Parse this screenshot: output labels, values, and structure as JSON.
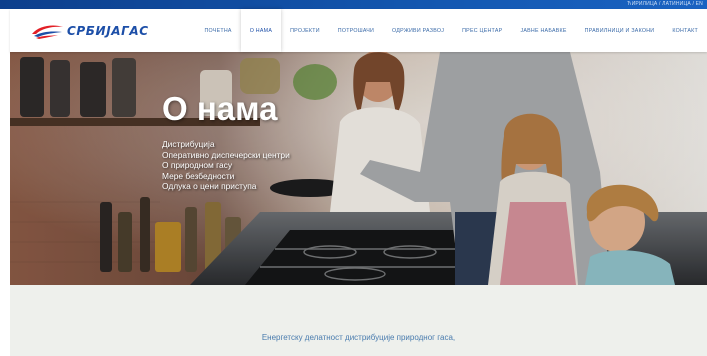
{
  "top_bar": {
    "language_link": "ЋИРИЛИЦА / ЛАТИНИЦА / EN",
    "color": "#1357b0"
  },
  "header": {
    "logo_text": "СРБИЈАГАС",
    "logo_icon": "gas-flame-logo-icon",
    "brand_color": "#1d4fa8",
    "nav": [
      {
        "label": "ПОЧЕТНА",
        "active": false
      },
      {
        "label": "О НАМА",
        "active": true
      },
      {
        "label": "ПРОЈЕКТИ",
        "active": false
      },
      {
        "label": "ПОТРОШАЧИ",
        "active": false
      },
      {
        "label": "ОДРЖИВИ РАЗВОЈ",
        "active": false
      },
      {
        "label": "ПРЕС ЦЕНТАР",
        "active": false
      },
      {
        "label": "ЈАВНЕ НАБАВКЕ",
        "active": false
      },
      {
        "label": "ПРАВИЛНИЦИ И ЗАКОНИ",
        "active": false
      },
      {
        "label": "КОНТАКТ",
        "active": false
      }
    ]
  },
  "hero": {
    "title": "О нама",
    "image_description_icon": "kitchen-family-cooking-photo",
    "links": [
      "Дистрибуција",
      "Оперативно диспечерски центри",
      "О природном гасу",
      "Мере безбедности",
      "Одлука о цени приступа"
    ]
  },
  "intro": {
    "text": "Енергетску делатност дистрибуције природног гаса,",
    "background_color": "#eef0ec",
    "text_color": "#4a7cae"
  }
}
